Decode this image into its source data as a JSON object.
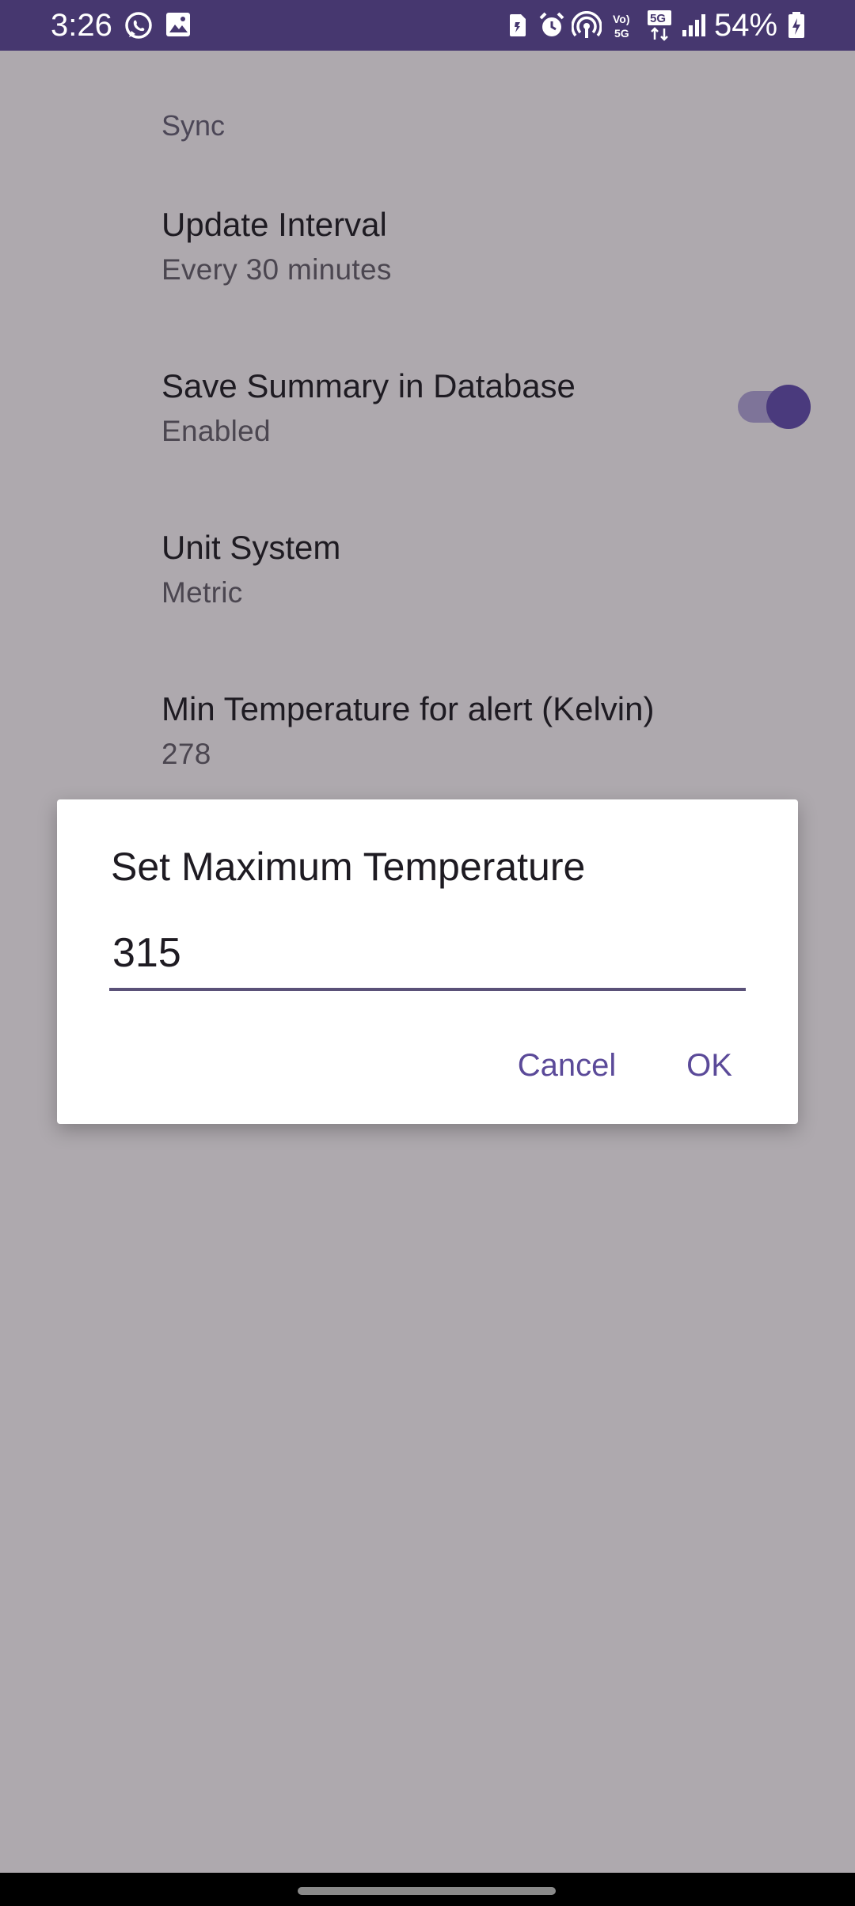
{
  "status_bar": {
    "time": "3:26",
    "battery_percent": "54%",
    "icons_left": [
      "whatsapp-icon",
      "gallery-icon"
    ],
    "icons_right": [
      "sim-icon",
      "alarm-icon",
      "hotspot-icon",
      "volte-5g-icon",
      "5g-data-icon",
      "signal-icon",
      "battery-charging-icon"
    ]
  },
  "settings": {
    "section_header": "Sync",
    "items": [
      {
        "title": "Update Interval",
        "summary": "Every 30 minutes"
      },
      {
        "title": "Save Summary in Database",
        "summary": "Enabled",
        "toggle_on": true
      },
      {
        "title": "Unit System",
        "summary": "Metric"
      },
      {
        "title": "Min Temperature for alert (Kelvin)",
        "summary": "278"
      }
    ]
  },
  "dialog": {
    "title": "Set Maximum Temperature",
    "input_value": "315",
    "cancel_label": "Cancel",
    "ok_label": "OK"
  },
  "colors": {
    "status_bar": "#46376f",
    "scrim_background": "#aea9ae",
    "accent": "#5b4a99",
    "toggle_thumb": "#4a3a7d"
  }
}
